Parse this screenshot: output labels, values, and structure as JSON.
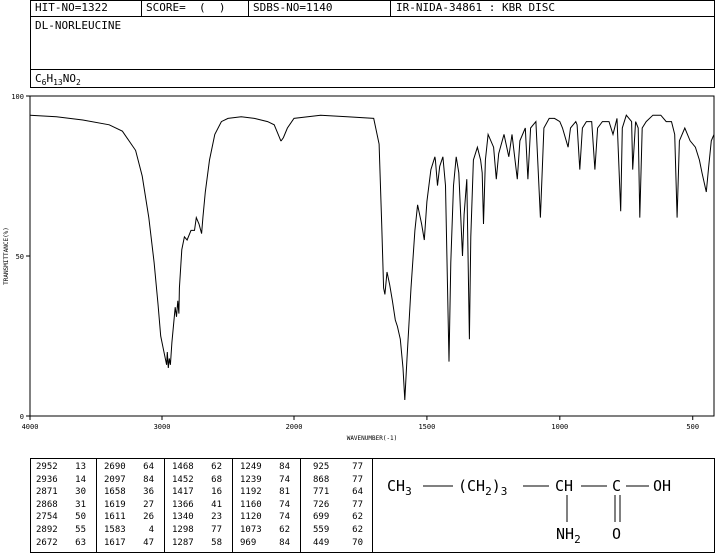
{
  "header": {
    "hit": "HIT-NO=1322",
    "score": "SCORE=  (  )",
    "sdbs": "SDBS-NO=1140",
    "nida": "IR-NIDA-34861 : KBR DISC",
    "compound": "DL-NORLEUCINE",
    "formula_parts": [
      "C",
      "6",
      "H",
      "13",
      "NO",
      "2"
    ]
  },
  "chart_data": {
    "type": "line",
    "xlabel": "WAVENUMBER(-1)",
    "ylabel": "TRANSMITTANCE(%)",
    "xlim": [
      4000,
      420
    ],
    "ylim": [
      0,
      100
    ],
    "x_ticks": [
      4000,
      3000,
      2000,
      1500,
      1000,
      500
    ],
    "y_ticks": [
      0,
      50,
      100
    ],
    "tick_labels_x": [
      "4000",
      "3000",
      "2000",
      "1500",
      "1000",
      "500"
    ],
    "tick_labels_y": [
      "0",
      "50",
      "100"
    ],
    "grid": false,
    "series": [
      {
        "color": "#000000",
        "points": [
          [
            4000,
            94
          ],
          [
            3800,
            93.5
          ],
          [
            3600,
            92.5
          ],
          [
            3400,
            91
          ],
          [
            3300,
            89
          ],
          [
            3200,
            83
          ],
          [
            3150,
            75
          ],
          [
            3100,
            62
          ],
          [
            3060,
            48
          ],
          [
            3030,
            35
          ],
          [
            3010,
            25
          ],
          [
            2990,
            21
          ],
          [
            2965,
            16
          ],
          [
            2960,
            20
          ],
          [
            2952,
            15
          ],
          [
            2945,
            18
          ],
          [
            2936,
            16
          ],
          [
            2925,
            23
          ],
          [
            2900,
            34
          ],
          [
            2890,
            31
          ],
          [
            2880,
            36
          ],
          [
            2872,
            32
          ],
          [
            2868,
            40
          ],
          [
            2850,
            52
          ],
          [
            2830,
            56
          ],
          [
            2810,
            55
          ],
          [
            2780,
            58
          ],
          [
            2754,
            58
          ],
          [
            2740,
            62
          ],
          [
            2720,
            60
          ],
          [
            2700,
            57
          ],
          [
            2690,
            62
          ],
          [
            2672,
            70
          ],
          [
            2640,
            80
          ],
          [
            2600,
            88
          ],
          [
            2550,
            92
          ],
          [
            2500,
            93
          ],
          [
            2400,
            93.5
          ],
          [
            2300,
            93
          ],
          [
            2200,
            92
          ],
          [
            2150,
            91
          ],
          [
            2120,
            88
          ],
          [
            2100,
            86
          ],
          [
            2097,
            86
          ],
          [
            2080,
            87
          ],
          [
            2050,
            90
          ],
          [
            2000,
            93
          ],
          [
            1900,
            94
          ],
          [
            1800,
            93.5
          ],
          [
            1700,
            93
          ],
          [
            1680,
            85
          ],
          [
            1670,
            60
          ],
          [
            1663,
            40
          ],
          [
            1658,
            38
          ],
          [
            1650,
            45
          ],
          [
            1640,
            41
          ],
          [
            1630,
            36
          ],
          [
            1619,
            30
          ],
          [
            1611,
            28
          ],
          [
            1600,
            24
          ],
          [
            1590,
            15
          ],
          [
            1583,
            5
          ],
          [
            1575,
            18
          ],
          [
            1560,
            40
          ],
          [
            1545,
            58
          ],
          [
            1535,
            66
          ],
          [
            1520,
            60
          ],
          [
            1510,
            55
          ],
          [
            1500,
            67
          ],
          [
            1485,
            77
          ],
          [
            1470,
            81
          ],
          [
            1468,
            80
          ],
          [
            1460,
            72
          ],
          [
            1452,
            78
          ],
          [
            1440,
            81
          ],
          [
            1430,
            72
          ],
          [
            1417,
            17
          ],
          [
            1410,
            48
          ],
          [
            1400,
            72
          ],
          [
            1390,
            81
          ],
          [
            1380,
            76
          ],
          [
            1366,
            50
          ],
          [
            1360,
            63
          ],
          [
            1350,
            74
          ],
          [
            1340,
            24
          ],
          [
            1335,
            56
          ],
          [
            1325,
            80
          ],
          [
            1310,
            84
          ],
          [
            1298,
            80
          ],
          [
            1292,
            76
          ],
          [
            1287,
            60
          ],
          [
            1280,
            80
          ],
          [
            1270,
            88
          ],
          [
            1249,
            84
          ],
          [
            1239,
            74
          ],
          [
            1230,
            82
          ],
          [
            1210,
            88
          ],
          [
            1192,
            81
          ],
          [
            1180,
            88
          ],
          [
            1160,
            74
          ],
          [
            1150,
            86
          ],
          [
            1130,
            90
          ],
          [
            1120,
            74
          ],
          [
            1110,
            90
          ],
          [
            1090,
            92
          ],
          [
            1073,
            62
          ],
          [
            1060,
            90
          ],
          [
            1040,
            93
          ],
          [
            1020,
            93
          ],
          [
            1000,
            92
          ],
          [
            990,
            90
          ],
          [
            969,
            84
          ],
          [
            960,
            90
          ],
          [
            940,
            92
          ],
          [
            935,
            91
          ],
          [
            925,
            77
          ],
          [
            915,
            90
          ],
          [
            900,
            92
          ],
          [
            880,
            92
          ],
          [
            868,
            77
          ],
          [
            858,
            90
          ],
          [
            840,
            92
          ],
          [
            815,
            92
          ],
          [
            800,
            88
          ],
          [
            785,
            93
          ],
          [
            771,
            64
          ],
          [
            765,
            90
          ],
          [
            750,
            94
          ],
          [
            730,
            92
          ],
          [
            726,
            77
          ],
          [
            715,
            92
          ],
          [
            705,
            90
          ],
          [
            699,
            62
          ],
          [
            690,
            90
          ],
          [
            675,
            92
          ],
          [
            650,
            94
          ],
          [
            620,
            94
          ],
          [
            600,
            92
          ],
          [
            580,
            92
          ],
          [
            568,
            88
          ],
          [
            559,
            62
          ],
          [
            550,
            86
          ],
          [
            530,
            90
          ],
          [
            510,
            86
          ],
          [
            490,
            84
          ],
          [
            475,
            80
          ],
          [
            465,
            76
          ],
          [
            449,
            70
          ],
          [
            440,
            78
          ],
          [
            430,
            86
          ],
          [
            420,
            88
          ]
        ]
      }
    ]
  },
  "peak_table": [
    [
      [
        "2952",
        "13"
      ],
      [
        "2936",
        "14"
      ],
      [
        "2871",
        "30"
      ],
      [
        "2868",
        "31"
      ],
      [
        "2754",
        "50"
      ],
      [
        "2892",
        "55"
      ],
      [
        "2672",
        "63"
      ]
    ],
    [
      [
        "2690",
        "64"
      ],
      [
        "2097",
        "84"
      ],
      [
        "1658",
        "36"
      ],
      [
        "1619",
        "27"
      ],
      [
        "1611",
        "26"
      ],
      [
        "1583",
        "4"
      ],
      [
        "1617",
        "47"
      ]
    ],
    [
      [
        "1468",
        "62"
      ],
      [
        "1452",
        "68"
      ],
      [
        "1417",
        "16"
      ],
      [
        "1366",
        "41"
      ],
      [
        "1340",
        "23"
      ],
      [
        "1298",
        "77"
      ],
      [
        "1287",
        "58"
      ]
    ],
    [
      [
        "1249",
        "84"
      ],
      [
        "1239",
        "74"
      ],
      [
        "1192",
        "81"
      ],
      [
        "1160",
        "74"
      ],
      [
        "1120",
        "74"
      ],
      [
        "1073",
        "62"
      ],
      [
        "969",
        "84"
      ]
    ],
    [
      [
        "925",
        "77"
      ],
      [
        "868",
        "77"
      ],
      [
        "771",
        "64"
      ],
      [
        "726",
        "77"
      ],
      [
        "699",
        "62"
      ],
      [
        "559",
        "62"
      ],
      [
        "449",
        "70"
      ]
    ]
  ],
  "structure": {
    "ch3": "CH",
    "ch3_sub": "3",
    "chain_open": "(CH",
    "chain_sub": "2",
    "chain_close": ")",
    "chain_count": "3",
    "ch": "CH",
    "c": "C",
    "oh": "OH",
    "nh2": "NH",
    "nh2_sub": "2",
    "o": "O"
  }
}
